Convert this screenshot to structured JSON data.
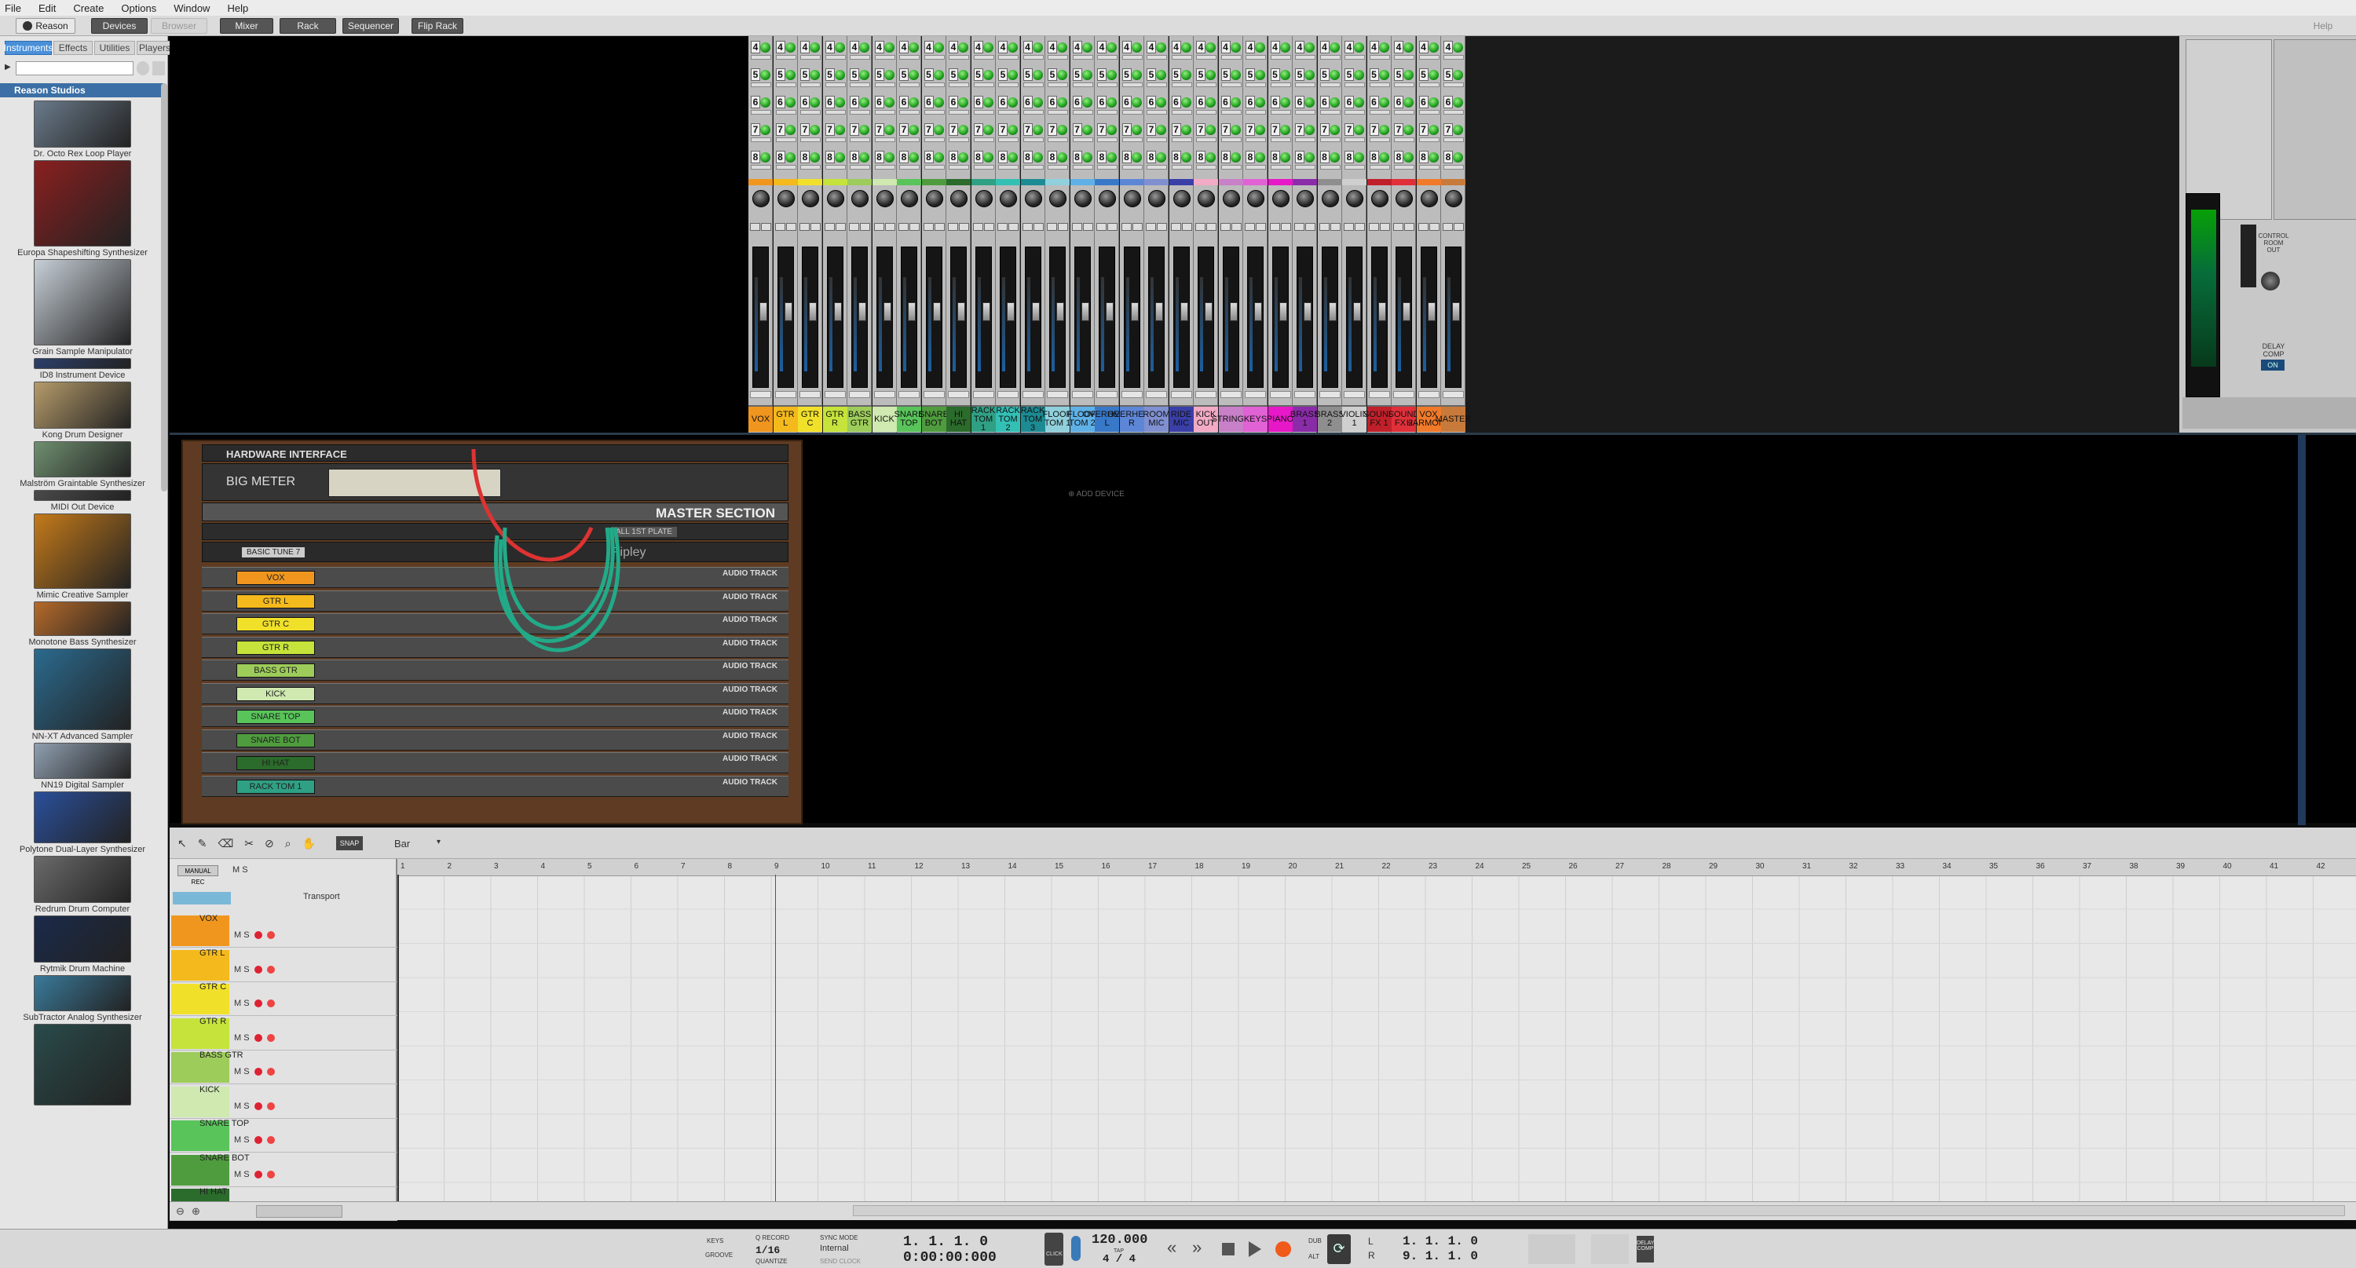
{
  "menu": [
    "File",
    "Edit",
    "Create",
    "Options",
    "Window",
    "Help"
  ],
  "toolbar": {
    "logo": "Reason",
    "devices": "Devices",
    "browser": "Browser",
    "mixer": "Mixer",
    "rack": "Rack",
    "sequencer": "Sequencer",
    "flip_rack": "Flip Rack",
    "help": "Help"
  },
  "browser_tabs": [
    "Instruments",
    "Effects",
    "Utilities",
    "Players"
  ],
  "browser_section": "Reason Studios",
  "devices": [
    {
      "name": "Dr. Octo Rex Loop Player",
      "color": "#6a7a8a"
    },
    {
      "name": "Europa Shapeshifting Synthesizer",
      "color": "#8a1f1f"
    },
    {
      "name": "Grain Sample Manipulator",
      "color": "#c7cfd7"
    },
    {
      "name": "ID8 Instrument Device",
      "color": "#2c3f6a"
    },
    {
      "name": "Kong Drum Designer",
      "color": "#b59b6a"
    },
    {
      "name": "Malström Graintable Synthesizer",
      "color": "#6f8f6f"
    },
    {
      "name": "MIDI Out Device",
      "color": "#4a4a4a"
    },
    {
      "name": "Mimic Creative Sampler",
      "color": "#c47a1a"
    },
    {
      "name": "Monotone Bass Synthesizer",
      "color": "#b56a2a"
    },
    {
      "name": "NN-XT Advanced Sampler",
      "color": "#2b6a8e"
    },
    {
      "name": "NN19 Digital Sampler",
      "color": "#8f9fb0"
    },
    {
      "name": "Polytone Dual-Layer Synthesizer",
      "color": "#2a4f9a"
    },
    {
      "name": "Redrum Drum Computer",
      "color": "#6a6a6a"
    },
    {
      "name": "Rytmik Drum Machine",
      "color": "#1a2a4a"
    },
    {
      "name": "SubTractor Analog Synthesizer",
      "color": "#3a7a9a"
    },
    {
      "name": "",
      "color": "#2a4a4a"
    }
  ],
  "mixer": {
    "channels": [
      {
        "name": "VOX",
        "color": "#f0961e"
      },
      {
        "name": "GTR L",
        "color": "#f4b91c"
      },
      {
        "name": "GTR C",
        "color": "#f1e02a"
      },
      {
        "name": "GTR R",
        "color": "#c5e33a"
      },
      {
        "name": "BASS GTR",
        "color": "#9dcc5a"
      },
      {
        "name": "KICK",
        "color": "#cfe9b0"
      },
      {
        "name": "SNARE TOP",
        "color": "#58c45a"
      },
      {
        "name": "SNARE BOT",
        "color": "#4f9c3e"
      },
      {
        "name": "HI HAT",
        "color": "#2b6b2b"
      },
      {
        "name": "RACK TOM 1",
        "color": "#2fa084"
      },
      {
        "name": "RACK TOM 2",
        "color": "#33c0b5"
      },
      {
        "name": "RACK TOM 3",
        "color": "#1c8b93"
      },
      {
        "name": "FLOOR TOM 1",
        "color": "#8fd0dc"
      },
      {
        "name": "FLOOR TOM 2",
        "color": "#5fb0e6"
      },
      {
        "name": "OVERHEAD L",
        "color": "#3878c8"
      },
      {
        "name": "OVERHEAD R",
        "color": "#5d86d6"
      },
      {
        "name": "ROOM MIC",
        "color": "#7f8fd0"
      },
      {
        "name": "RIDE MIC",
        "color": "#3a3fa8"
      },
      {
        "name": "KICK OUT",
        "color": "#f2aac5"
      },
      {
        "name": "STRINGS",
        "color": "#c880c8"
      },
      {
        "name": "KEYS",
        "color": "#e062d4"
      },
      {
        "name": "PIANO",
        "color": "#e618c8"
      },
      {
        "name": "BRASS 1",
        "color": "#8a2ba8"
      },
      {
        "name": "BRASS 2",
        "color": "#8e8e8e"
      },
      {
        "name": "VIOLIN 1",
        "color": "#cfcfcf"
      },
      {
        "name": "SOUND FX 1",
        "color": "#c0202a"
      },
      {
        "name": "SOUND FX 2",
        "color": "#e0303a"
      },
      {
        "name": "VOX HARMONY",
        "color": "#f07a2a"
      },
      {
        "name": "MASTER",
        "color": "#c87a3a"
      }
    ],
    "send_numbers": [
      "4",
      "5",
      "6",
      "7",
      "8"
    ],
    "master_labels": {
      "control_room": "CONTROL ROOM OUT",
      "delay_comp": "DELAY COMP",
      "on": "ON"
    }
  },
  "rack": {
    "hardware_interface": "HARDWARE INTERFACE",
    "big_meter": "BIG METER",
    "master_section": "MASTER SECTION",
    "ripley": "Ripley",
    "preset1": "BASIC TUNE 7",
    "preset2": "ALL 1ST PLATE",
    "add_device": "ADD DEVICE",
    "audio_track_label": "AUDIO TRACK",
    "tracks": [
      {
        "name": "VOX",
        "color": "#f0961e"
      },
      {
        "name": "GTR L",
        "color": "#f4b91c"
      },
      {
        "name": "GTR C",
        "color": "#f1e02a"
      },
      {
        "name": "GTR R",
        "color": "#c5e33a"
      },
      {
        "name": "BASS GTR",
        "color": "#9dcc5a"
      },
      {
        "name": "KICK",
        "color": "#cfe9b0"
      },
      {
        "name": "SNARE TOP",
        "color": "#58c45a"
      },
      {
        "name": "SNARE BOT",
        "color": "#4f9c3e"
      },
      {
        "name": "HI HAT",
        "color": "#2b6b2b"
      },
      {
        "name": "RACK TOM 1",
        "color": "#2fa084"
      }
    ]
  },
  "sequencer": {
    "snap_label": "SNAP",
    "snap_value": "Bar",
    "manual_rec": "MANUAL REC",
    "transport_track": "Transport",
    "ms": "M S",
    "tracks": [
      {
        "name": "VOX",
        "color": "#f0961e"
      },
      {
        "name": "GTR L",
        "color": "#f4b91c"
      },
      {
        "name": "GTR C",
        "color": "#f1e02a"
      },
      {
        "name": "GTR R",
        "color": "#c5e33a"
      },
      {
        "name": "BASS GTR",
        "color": "#9dcc5a"
      },
      {
        "name": "KICK",
        "color": "#cfe9b0"
      },
      {
        "name": "SNARE TOP",
        "color": "#58c45a"
      },
      {
        "name": "SNARE BOT",
        "color": "#4f9c3e"
      },
      {
        "name": "HI HAT",
        "color": "#2b6b2b"
      }
    ],
    "ruler": [
      "1",
      "2",
      "3",
      "4",
      "5",
      "6",
      "7",
      "8",
      "9",
      "10",
      "11",
      "12",
      "13",
      "14",
      "15",
      "16",
      "17",
      "18",
      "19",
      "20",
      "21",
      "22",
      "23",
      "24",
      "25",
      "26",
      "27",
      "28",
      "29",
      "30",
      "31",
      "32",
      "33",
      "34",
      "35",
      "36",
      "37",
      "38",
      "39",
      "40",
      "41",
      "42"
    ]
  },
  "transport": {
    "keys": "KEYS",
    "groove": "GROOVE",
    "q_record": "Q RECORD",
    "quantize_value": "1/16",
    "quantize": "QUANTIZE",
    "sync_mode": "SYNC MODE",
    "sync_value": "Internal",
    "send_clock": "SEND CLOCK",
    "position_bars": "1.  1.  1.    0",
    "position_time": "0:00:00:000",
    "click": "CLICK",
    "pre": "PRE",
    "tempo": "120.000",
    "tap": "TAP",
    "signature": "4 / 4",
    "dub": "DUB",
    "alt": "ALT",
    "loop_left": "1.  1.  1.    0",
    "loop_right": "9.  1.  1.    0",
    "l": "L",
    "r": "R",
    "delay_comp": "DELAY COMP"
  }
}
